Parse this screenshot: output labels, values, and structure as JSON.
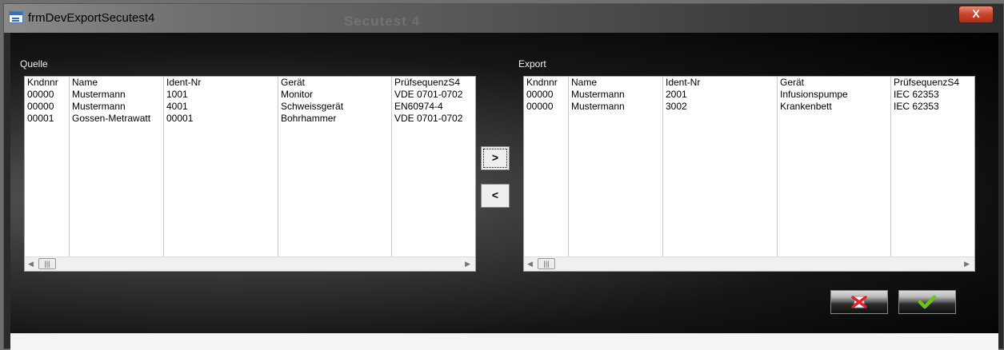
{
  "window": {
    "title": "frmDevExportSecutest4",
    "background_caption": "Secutest 4",
    "close_symbol": "X"
  },
  "source": {
    "label": "Quelle",
    "columns": [
      "Kndnnr",
      "Name",
      "Ident-Nr",
      "Gerät",
      "PrüfsequenzS4"
    ],
    "rows": [
      [
        "00000",
        "Mustermann",
        "1001",
        "Monitor",
        "VDE 0701-0702"
      ],
      [
        "00000",
        "Mustermann",
        "4001",
        "Schweissgerät",
        "EN60974-4"
      ],
      [
        "00001",
        "Gossen-Metrawatt",
        "00001",
        "Bohrhammer",
        "VDE 0701-0702"
      ]
    ]
  },
  "export": {
    "label": "Export",
    "columns": [
      "Kndnnr",
      "Name",
      "Ident-Nr",
      "Gerät",
      "PrüfsequenzS4"
    ],
    "rows": [
      [
        "00000",
        "Mustermann",
        "2001",
        "Infusionspumpe",
        "IEC 62353"
      ],
      [
        "00000",
        "Mustermann",
        "3002",
        "Krankenbett",
        "IEC 62353"
      ]
    ]
  },
  "buttons": {
    "move_right": ">",
    "move_left": "<",
    "cancel_icon": "red-x-icon",
    "ok_icon": "green-check-icon"
  },
  "scrollbar": {
    "left_arrow": "◀",
    "right_arrow": "▶",
    "thumb_grip": "|||"
  },
  "colors": {
    "listbox_bg": "#ffffff",
    "label_text": "#f0f0f0",
    "close_red": "#c7452c",
    "cancel_red": "#e0202a",
    "ok_green": "#6cc21c"
  }
}
